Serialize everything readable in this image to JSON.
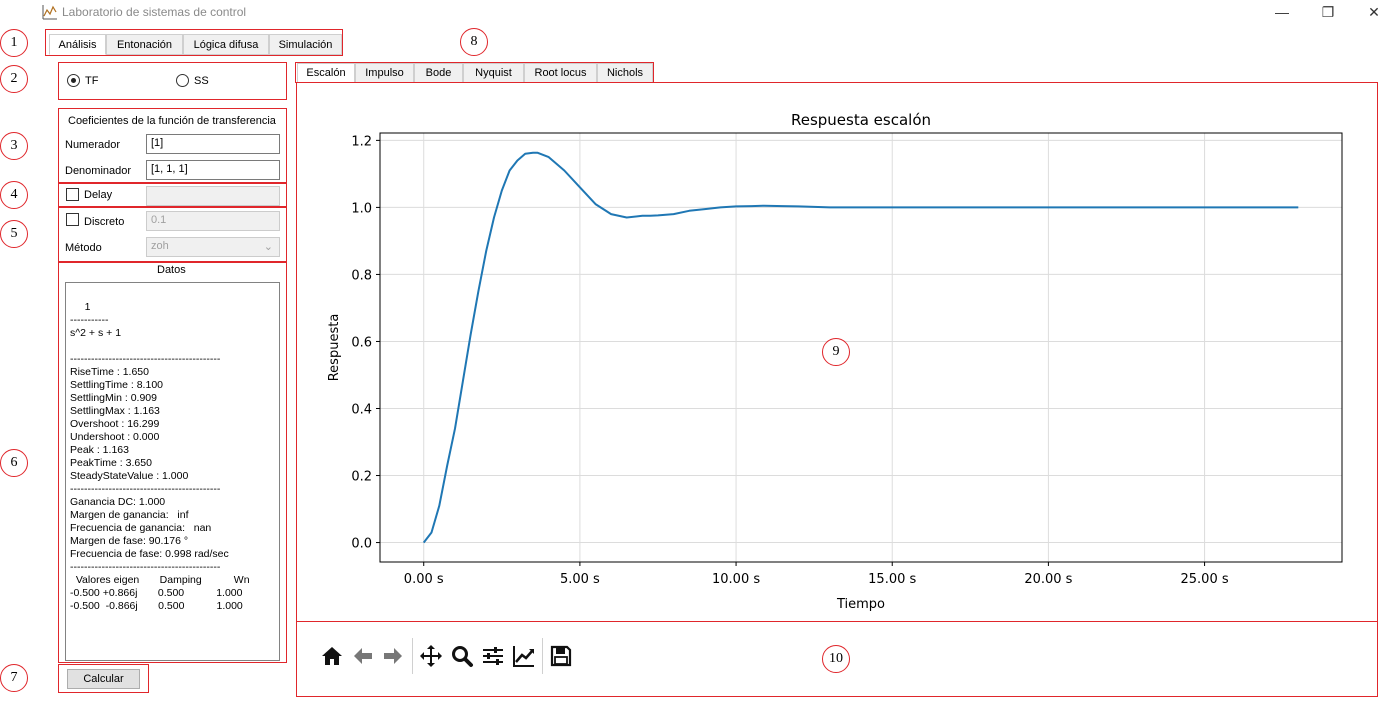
{
  "window": {
    "title": "Laboratorio de sistemas de control",
    "controls": {
      "minimize": "—",
      "restore": "❐",
      "close": "✕"
    }
  },
  "main_tabs": [
    "Análisis",
    "Entonación",
    "Lógica difusa",
    "Simulación"
  ],
  "model_type": {
    "tf_label": "TF",
    "ss_label": "SS",
    "selected": "TF"
  },
  "tf_coeffs": {
    "title": "Coeficientes de la función de transferencia",
    "numerator_label": "Numerador",
    "numerator_value": "[1]",
    "denominator_label": "Denominador",
    "denominator_value": "[1, 1, 1]"
  },
  "delay": {
    "label": "Delay",
    "checked": false,
    "value": ""
  },
  "discrete": {
    "label": "Discreto",
    "checked": false,
    "value": "0.1",
    "method_label": "Método",
    "method_value": "zoh"
  },
  "datos": {
    "title": "Datos",
    "text": "     1\n-----------\ns^2 + s + 1\n\n-------------------------------------------\nRiseTime : 1.650\nSettlingTime : 8.100\nSettlingMin : 0.909\nSettlingMax : 1.163\nOvershoot : 16.299\nUndershoot : 0.000\nPeak : 1.163\nPeakTime : 3.650\nSteadyStateValue : 1.000\n-------------------------------------------\nGanancia DC: 1.000\nMargen de ganancia:   inf\nFrecuencia de ganancia:   nan\nMargen de fase: 90.176 °\nFrecuencia de fase: 0.998 rad/sec\n-------------------------------------------\n  Valores eigen       Damping           Wn\n-0.500 +0.866j       0.500           1.000\n-0.500  -0.866j       0.500           1.000"
  },
  "calcular_label": "Calcular",
  "plot_tabs": [
    "Escalón",
    "Impulso",
    "Bode",
    "Nyquist",
    "Root locus",
    "Nichols"
  ],
  "callouts": [
    "1",
    "2",
    "3",
    "4",
    "5",
    "6",
    "7",
    "8",
    "9",
    "10"
  ],
  "toolbar_icons": [
    "home-icon",
    "back-arrow-icon",
    "forward-arrow-icon",
    "pan-icon",
    "zoom-icon",
    "subplots-config-icon",
    "edit-axes-icon",
    "save-icon"
  ],
  "colors": {
    "accent_red": "#e0262b",
    "series": "#1f77b4"
  },
  "chart_data": {
    "type": "line",
    "title": "Respuesta escalón",
    "xlabel": "Tiempo",
    "ylabel": "Respuesta",
    "xlim": [
      -1.4,
      29.4
    ],
    "ylim": [
      -0.058,
      1.222
    ],
    "xticks": [
      0,
      5,
      10,
      15,
      20,
      25
    ],
    "xtick_labels": [
      "0.00 s",
      "5.00 s",
      "10.00 s",
      "15.00 s",
      "20.00 s",
      "25.00 s"
    ],
    "yticks": [
      0.0,
      0.2,
      0.4,
      0.6,
      0.8,
      1.0,
      1.2
    ],
    "ytick_labels": [
      "0.0",
      "0.2",
      "0.4",
      "0.6",
      "0.8",
      "1.0",
      "1.2"
    ],
    "grid": true,
    "series": [
      {
        "x": [
          0,
          0.25,
          0.5,
          0.75,
          1.0,
          1.25,
          1.5,
          1.75,
          2.0,
          2.25,
          2.5,
          2.75,
          3.0,
          3.25,
          3.5,
          3.65,
          4.0,
          4.5,
          5.0,
          5.5,
          6.0,
          6.5,
          7.0,
          7.25,
          7.5,
          8.0,
          8.5,
          9.0,
          9.5,
          10.0,
          10.5,
          10.9,
          11.5,
          12.0,
          13.0,
          14.0,
          15.0,
          16.0,
          18.0,
          20.0,
          22.0,
          24.0,
          26.0,
          28.0
        ],
        "y": [
          0.0,
          0.03,
          0.11,
          0.23,
          0.34,
          0.48,
          0.62,
          0.75,
          0.87,
          0.97,
          1.05,
          1.11,
          1.14,
          1.16,
          1.163,
          1.163,
          1.15,
          1.11,
          1.06,
          1.01,
          0.98,
          0.97,
          0.975,
          0.975,
          0.976,
          0.98,
          0.99,
          0.995,
          1.0,
          1.003,
          1.004,
          1.005,
          1.004,
          1.003,
          1.0,
          1.0,
          1.0,
          1.0,
          1.0,
          1.0,
          1.0,
          1.0,
          1.0,
          1.0
        ]
      }
    ]
  }
}
